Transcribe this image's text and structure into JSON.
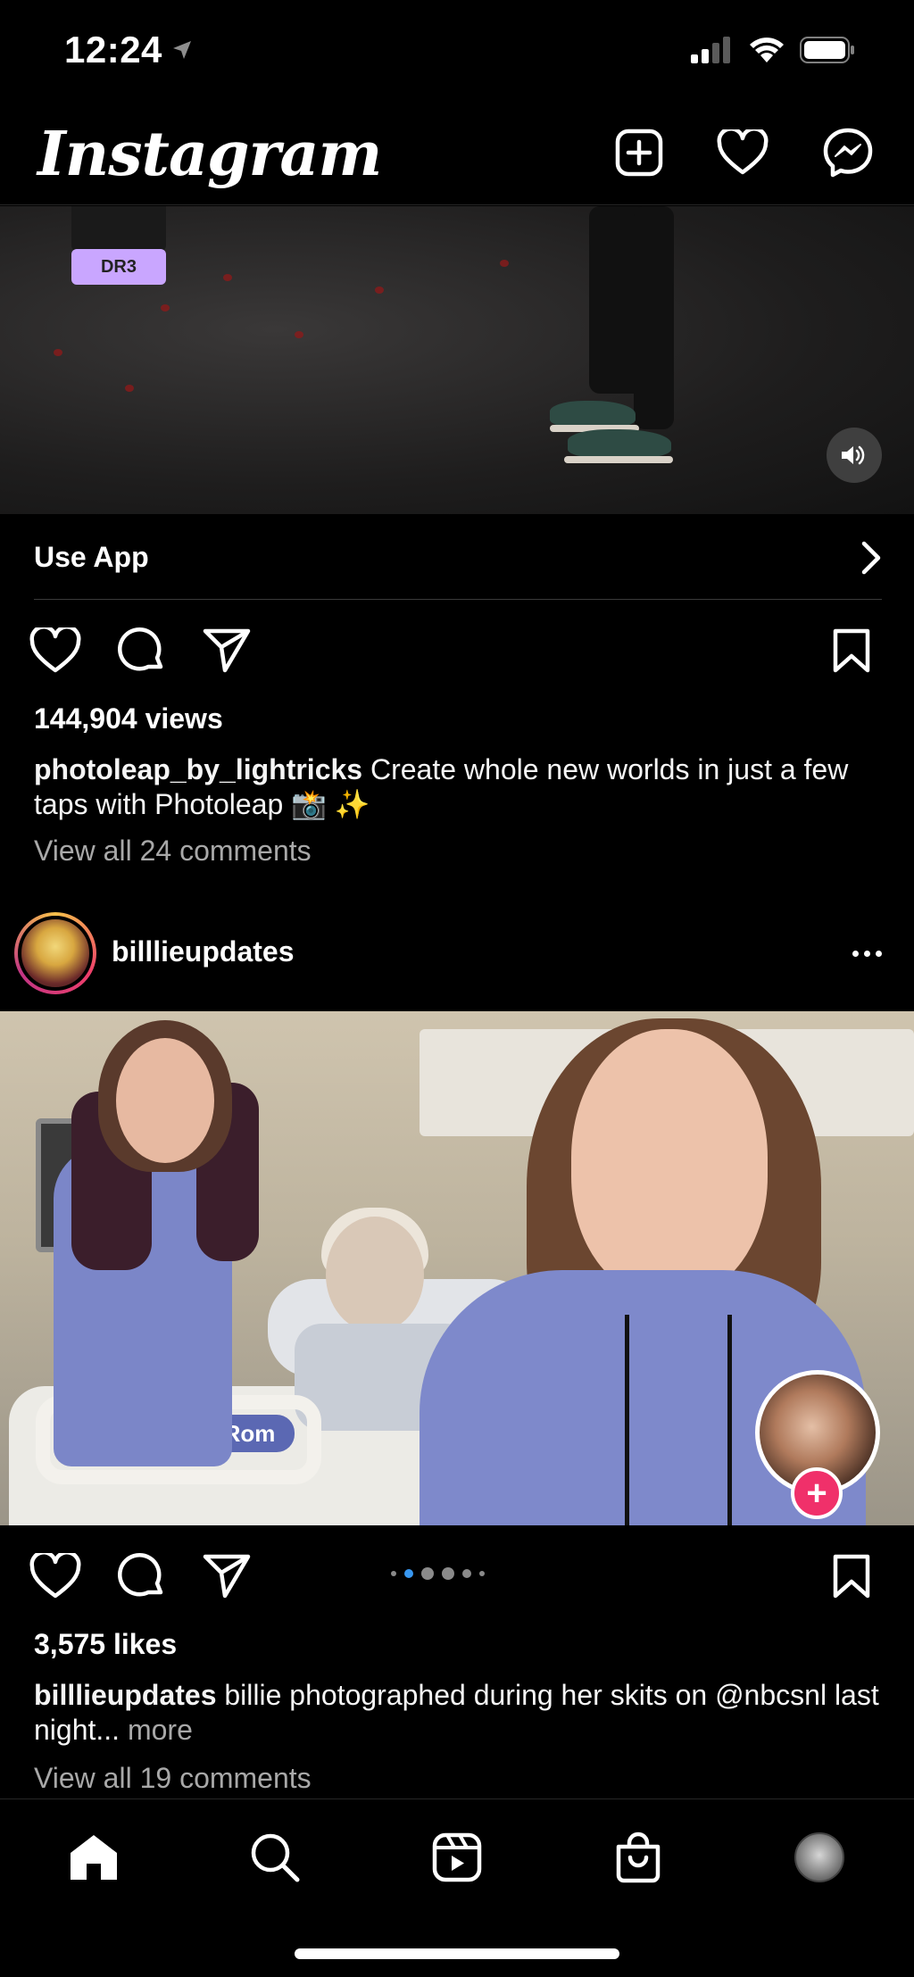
{
  "status_bar": {
    "time": "12:24"
  },
  "header": {
    "logo": "Instagram"
  },
  "post1": {
    "media_tag": "DR3",
    "cta_label": "Use App",
    "views": "144,904 views",
    "username": "photoleap_by_lightricks",
    "caption": "Create whole new worlds in just a few taps with Photoleap 📸 ✨",
    "comments_link": "View all 24 comments"
  },
  "post2": {
    "username": "billlieupdates",
    "media_label": "Hill-Rom",
    "carousel": {
      "count": 6,
      "active_index": 1
    },
    "likes": "3,575 likes",
    "caption": "billie photographed during her skits on @nbcsnl last night...",
    "more_label": "more",
    "comments_link": "View all 19 comments"
  },
  "colors": {
    "background": "#000000",
    "accent_blue": "#3897f0",
    "muted_text": "#a8a8a8",
    "add_badge": "#f0306a"
  },
  "icons": [
    "location-arrow-icon",
    "signal-icon",
    "wifi-icon",
    "battery-icon",
    "new-post-icon",
    "heart-icon",
    "messenger-icon",
    "volume-icon",
    "chevron-right-icon",
    "comment-icon",
    "share-icon",
    "bookmark-icon",
    "more-icon",
    "home-icon",
    "search-icon",
    "reels-icon",
    "shop-icon"
  ]
}
